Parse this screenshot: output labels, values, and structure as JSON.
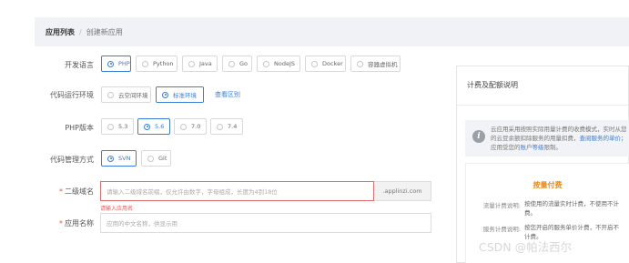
{
  "breadcrumb": {
    "parent": "应用列表",
    "separator": "/",
    "current": "创建新应用"
  },
  "form": {
    "language": {
      "label": "开发语言",
      "options": [
        "PHP",
        "Python",
        "Java",
        "Go",
        "NodeJS",
        "Docker",
        "容器虚拟机"
      ],
      "selected": "PHP"
    },
    "runtime": {
      "label": "代码运行环境",
      "options": [
        "云空间环境",
        "标准环境"
      ],
      "selected": "标准环境",
      "link": "查看区别"
    },
    "php_version": {
      "label": "PHP版本",
      "options": [
        "5.3",
        "5.6",
        "7.0",
        "7.4"
      ],
      "selected": "5.6"
    },
    "vcs": {
      "label": "代码管理方式",
      "options": [
        "SVN",
        "Git"
      ],
      "selected": "SVN"
    },
    "domain": {
      "required_mark": "*",
      "label": "二级域名",
      "placeholder": "请输入二级域名前缀，仅允许由数字，字母组成，长度为4到18位",
      "suffix": ".applinzi.com",
      "error": "请输入应用名"
    },
    "app_name": {
      "required_mark": "*",
      "label": "应用名称",
      "placeholder": "应用的中文名称，供显示用"
    }
  },
  "panel": {
    "title": "计费及配额说明",
    "info": {
      "icon": "info-icon",
      "text_before": "云应用采用按照实际用量计费的收费模式，实时从您的云豆余额扣除服务的用量扣费，",
      "link1": "查阅服务的单价",
      "text_middle": "；应用受您的",
      "link2": "账户等级",
      "text_after": "限制。"
    },
    "pricing": {
      "title": "按量付费",
      "traffic_label": "流量计费说明:",
      "traffic_text": "按使用的流量实时计费，不使用不计费。",
      "service_label": "服务计费说明:",
      "service_text": "按您开启的服务单价计费，不开启不计费。"
    }
  },
  "watermark": "CSDN @帕法西尔",
  "colors": {
    "accent": "#3b7dd8",
    "error": "#e55555",
    "pricing": "#e98a17"
  }
}
